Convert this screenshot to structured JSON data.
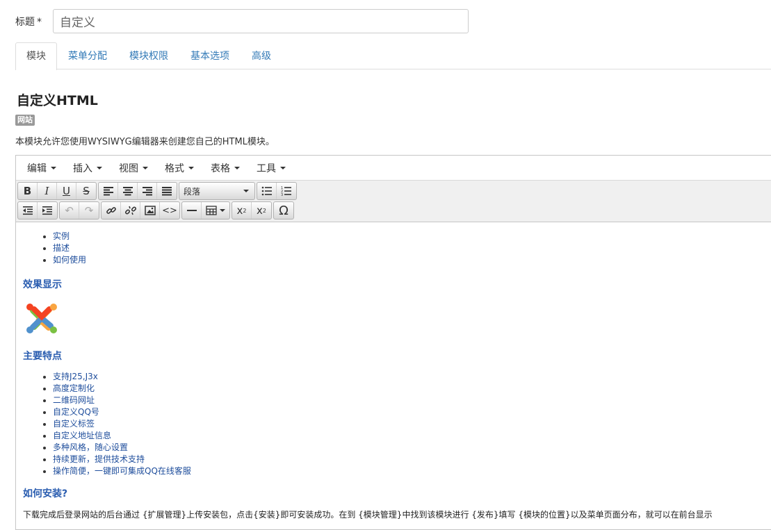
{
  "title_field": {
    "label": "标题",
    "required_mark": "*",
    "value": "自定义"
  },
  "tabs": [
    {
      "label": "模块",
      "active": true
    },
    {
      "label": "菜单分配",
      "active": false
    },
    {
      "label": "模块权限",
      "active": false
    },
    {
      "label": "基本选项",
      "active": false
    },
    {
      "label": "高级",
      "active": false
    }
  ],
  "module": {
    "title": "自定义HTML",
    "badge": "网站",
    "description": "本模块允许您使用WYSIWYG编辑器来创建您自己的HTML模块。"
  },
  "editor": {
    "menu": [
      "编辑",
      "插入",
      "视图",
      "格式",
      "表格",
      "工具"
    ],
    "toolbar": {
      "format_select": "段落",
      "icons": [
        "bold-icon",
        "italic-icon",
        "underline-icon",
        "strikethrough-icon",
        "align-left-icon",
        "align-center-icon",
        "align-right-icon",
        "align-justify-icon",
        "bullet-list-icon",
        "numbered-list-icon",
        "outdent-icon",
        "indent-icon",
        "undo-icon",
        "redo-icon",
        "link-icon",
        "unlink-icon",
        "image-icon",
        "code-icon",
        "horizontal-rule-icon",
        "table-icon",
        "subscript-icon",
        "superscript-icon",
        "omega-icon"
      ]
    },
    "content": {
      "toc": [
        "实例",
        "描述",
        "如何使用"
      ],
      "effect_heading": "效果显示",
      "features_heading": "主要特点",
      "features": [
        "支持J25,J3x",
        "高度定制化",
        "二维码网址",
        "自定义QQ号",
        "自定义标签",
        "自定义地址信息",
        "多种风格，随心设置",
        "持续更新，提供技术支持",
        "操作简便，一键即可集成QQ在线客服"
      ],
      "install_heading": "如何安装?",
      "install_text": "下载完成后登录网站的后台通过 {扩展管理}上传安装包，点击{安装}即可安装成功。在到 {模块管理}中找到该模块进行 {发布}填写 {模块的位置}以及菜单页面分布，就可以在前台显示"
    }
  }
}
